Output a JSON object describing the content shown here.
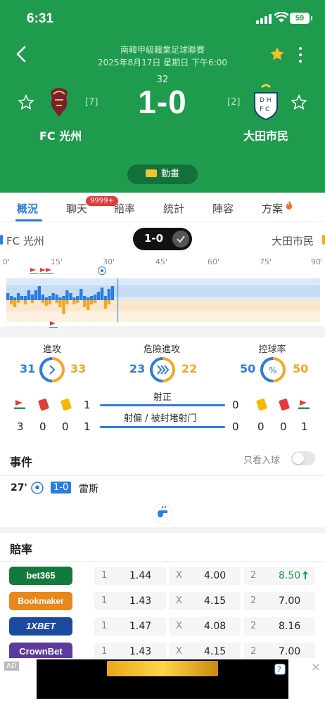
{
  "status": {
    "time": "6:31",
    "battery": "59"
  },
  "match": {
    "league": "南韓甲級職業足球聯賽",
    "datetime": "2025年8月17日 星期日 下午6:00",
    "minute": "32",
    "score": "1-0",
    "home": {
      "name": "FC 光州",
      "rank": "[7]"
    },
    "away": {
      "name": "大田市民",
      "rank": "[2]"
    },
    "animation_label": "動畫"
  },
  "tabs": [
    {
      "label": "概況",
      "active": true
    },
    {
      "label": "聊天"
    },
    {
      "label": "賠率"
    },
    {
      "label": "統計"
    },
    {
      "label": "陣容"
    },
    {
      "label": "方案"
    }
  ],
  "chat_badge": "9999+",
  "momentum": {
    "home": "FC 光州",
    "away": "大田市民",
    "score": "1-0",
    "ticks": [
      "0'",
      "15'",
      "30'",
      "45'",
      "60'",
      "75'",
      "90'"
    ],
    "home_bars": [
      10,
      6,
      4,
      10,
      6,
      6,
      14,
      8,
      14,
      20,
      8,
      4,
      6,
      10,
      8,
      4,
      6,
      14,
      10,
      4,
      6,
      16,
      6,
      4,
      6,
      8,
      12,
      18,
      6,
      16,
      20
    ],
    "away_bars": [
      0,
      6,
      10,
      4,
      0,
      6,
      0,
      4,
      0,
      0,
      4,
      8,
      6,
      0,
      4,
      10,
      20,
      6,
      0,
      6,
      4,
      0,
      10,
      14,
      6,
      4,
      0,
      0,
      12,
      6,
      0
    ],
    "current_minute": 32
  },
  "stats": {
    "attack": {
      "label": "進攻",
      "home": "31",
      "away": "33"
    },
    "danger": {
      "label": "危險進攻",
      "home": "23",
      "away": "22"
    },
    "possession": {
      "label": "控球率",
      "home": "50",
      "away": "50"
    },
    "on_target": {
      "label": "射正",
      "home": "1",
      "away": "0"
    },
    "off_target": {
      "label": "射偏 / 被封堵射门",
      "home": "1",
      "away": "0"
    },
    "home_corners": "3",
    "home_red": "0",
    "home_yellow": "0",
    "away_corners": "1",
    "away_red": "0",
    "away_yellow": "0",
    "home_on_target_row": "1",
    "away_on_target_row": "0"
  },
  "events": {
    "title": "事件",
    "filter_label": "只看入球",
    "items": [
      {
        "minute": "27'",
        "score": "1-0",
        "player": "雷斯"
      }
    ]
  },
  "odds": {
    "title": "賠率",
    "rows": [
      {
        "book": "bet365",
        "color": "#137a3d",
        "c1": "1",
        "v1": "1.44",
        "cx": "X",
        "vx": "4.00",
        "c2": "2",
        "v2": "8.50",
        "up": true
      },
      {
        "book": "Bookmaker",
        "color": "#e8871b",
        "c1": "1",
        "v1": "1.43",
        "cx": "X",
        "vx": "4.15",
        "c2": "2",
        "v2": "7.00"
      },
      {
        "book": "1XBET",
        "color": "#1c4a9e",
        "c1": "1",
        "v1": "1.47",
        "cx": "X",
        "vx": "4.08",
        "c2": "2",
        "v2": "8.16"
      },
      {
        "book": "CrownBet",
        "color": "#5d3a9e",
        "c1": "1",
        "v1": "1.43",
        "cx": "X",
        "vx": "4.15",
        "c2": "2",
        "v2": "7.00"
      }
    ]
  },
  "ad": {
    "tag": "AD"
  }
}
